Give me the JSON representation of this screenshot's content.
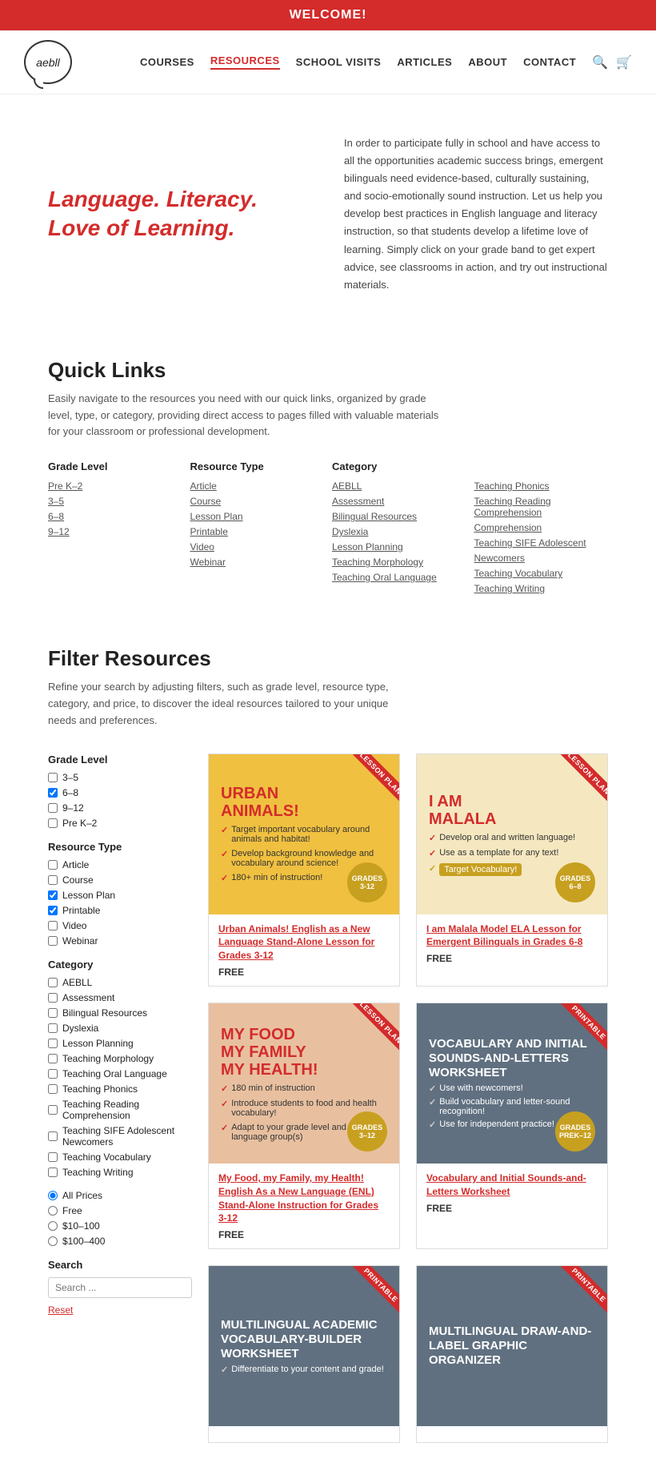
{
  "welcome_banner": "WELCOME!",
  "header": {
    "logo_text": "aebll",
    "nav_items": [
      {
        "label": "COURSES",
        "active": false
      },
      {
        "label": "RESOURCES",
        "active": true
      },
      {
        "label": "SCHOOL VISITS",
        "active": false
      },
      {
        "label": "ARTICLES",
        "active": false
      },
      {
        "label": "ABOUT",
        "active": false
      },
      {
        "label": "CONTACT",
        "active": false
      }
    ]
  },
  "hero": {
    "title_line1": "Language. Literacy.",
    "title_line2": "Love of Learning.",
    "description": "In order to participate fully in school and have access to all the opportunities academic success brings, emergent bilinguals need evidence-based, culturally sustaining, and socio-emotionally sound instruction. Let us help you develop best practices in English language and literacy instruction, so that students develop a lifetime love of learning. Simply click on your grade band to get expert advice, see classrooms in action, and try out instructional materials."
  },
  "quick_links": {
    "title": "Quick Links",
    "description": "Easily navigate to the resources you need with our quick links, organized by grade level, type, or category, providing direct access to pages filled with valuable materials for your classroom or professional development.",
    "grade_level": {
      "header": "Grade Level",
      "items": [
        "Pre K–2",
        "3–5",
        "6–8",
        "9–12"
      ]
    },
    "resource_type": {
      "header": "Resource Type",
      "items": [
        "Article",
        "Course",
        "Lesson Plan",
        "Printable",
        "Video",
        "Webinar"
      ]
    },
    "category": {
      "header": "Category",
      "items": [
        "AEBLL",
        "Assessment",
        "Bilingual Resources",
        "Dyslexia",
        "Lesson Planning",
        "Teaching Morphology",
        "Teaching Oral Language"
      ]
    },
    "category2": {
      "items": [
        "Teaching Phonics",
        "Teaching Reading Comprehension",
        "Comprehension",
        "Teaching SIFE Adolescent",
        "Newcomers",
        "Teaching Vocabulary",
        "Teaching Writing"
      ]
    }
  },
  "filter_resources": {
    "title": "Filter Resources",
    "description": "Refine your search by adjusting filters, such as grade level, resource type, category, and price, to discover the ideal resources tailored to your unique needs and preferences.",
    "grade_levels": [
      "3–5",
      "6–8",
      "9–12",
      "Pre K–2"
    ],
    "grade_checked": [
      false,
      true,
      false,
      false
    ],
    "resource_types": [
      "Article",
      "Course",
      "Lesson Plan",
      "Printable",
      "Video",
      "Webinar"
    ],
    "resource_checked": [
      false,
      false,
      true,
      true,
      false,
      false
    ],
    "categories": [
      "AEBLL",
      "Assessment",
      "Bilingual Resources",
      "Dyslexia",
      "Lesson Planning",
      "Teaching Morphology",
      "Teaching Oral Language",
      "Teaching Phonics",
      "Teaching Reading Comprehension",
      "Teaching SIFE Adolescent Newcomers",
      "Teaching Vocabulary",
      "Teaching Writing"
    ],
    "category_checked": [
      false,
      false,
      false,
      false,
      false,
      false,
      false,
      false,
      false,
      false,
      false,
      false
    ],
    "prices": [
      "All Prices",
      "Free",
      "$10–100",
      "$100–400"
    ],
    "price_selected": 0,
    "search_placeholder": "Search ..."
  },
  "cards": [
    {
      "id": "urban-animals",
      "title": "URBAN ANIMALS!",
      "ribbon": "LESSON PLAN",
      "bg": "yellow",
      "bullets": [
        "Target important vocabulary around animals and habitat!",
        "Develop background knowledge and vocabulary around science!",
        "180+ min of instruction!"
      ],
      "grade": "Grades\n3-12",
      "link_text": "Urban Animals! English as a New Language Stand-Alone Lesson for Grades 3-12",
      "price": "FREE"
    },
    {
      "id": "i-am-malala",
      "title": "I AM MALALA",
      "ribbon": "LESSON PLAN",
      "bg": "cream",
      "bullets": [
        "Develop oral and written language!",
        "Use as a template for any text!",
        "Target Vocabulary!"
      ],
      "grade": "GRADES\n6–8",
      "link_text": "I am Malala Model ELA Lesson for Emergent Bilinguals in Grades 6-8",
      "price": "FREE"
    },
    {
      "id": "my-food",
      "title": "MY FOOD MY FAMILY MY HEALTH!",
      "ribbon": "LESSON PLAN",
      "bg": "orange",
      "bullets": [
        "180 min of instruction",
        "Introduce students to food and health vocabulary!",
        "Adapt to your grade level and home language group(s)"
      ],
      "grade": "GRADES\n3–12",
      "link_text": "My Food, my Family, my Health! English As a New Language (ENL) Stand-Alone Instruction for Grades 3-12",
      "price": "FREE"
    },
    {
      "id": "vocabulary-worksheet",
      "title": "VOCABULARY AND INITIAL SOUNDS-AND-LETTERS WORKSHEET",
      "ribbon": "PRINTABLE",
      "bg": "gray",
      "bullets": [
        "Use with newcomers!",
        "Build vocabulary and letter-sound recognition!",
        "Use for independent practice!"
      ],
      "grade": "GRADES\nPreK–12",
      "link_text": "Vocabulary and Initial Sounds-and-Letters Worksheet",
      "price": "FREE"
    },
    {
      "id": "multilingual-vocab",
      "title": "MULTILINGUAL ACADEMIC VOCABULARY-BUILDER WORKSHEET",
      "ribbon": "PRINTABLE",
      "bg": "gray",
      "bullets": [
        "Differentiate to your content and grade!"
      ],
      "grade": "",
      "link_text": "",
      "price": ""
    },
    {
      "id": "multilingual-draw",
      "title": "MULTILINGUAL DRAW-AND-LABEL GRAPHIC ORGANIZER",
      "ribbon": "PRINTABLE",
      "bg": "gray",
      "bullets": [],
      "grade": "",
      "link_text": "",
      "price": ""
    }
  ]
}
